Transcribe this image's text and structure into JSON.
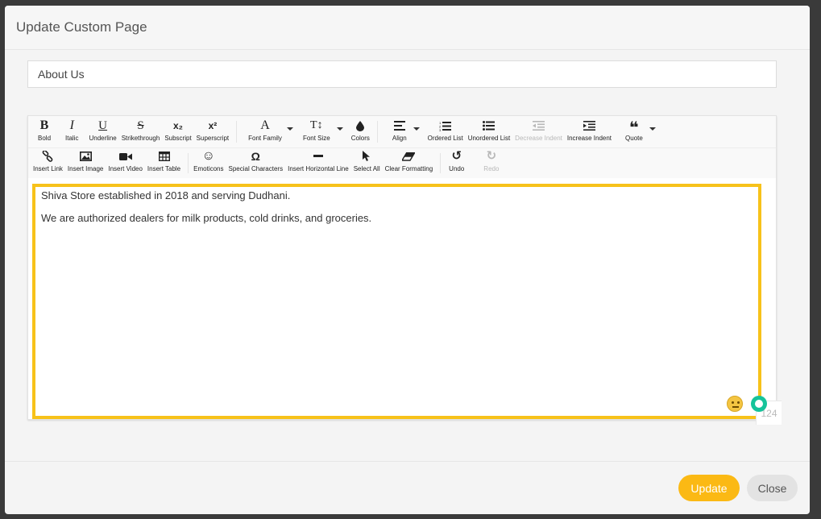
{
  "modal": {
    "title": "Update Custom Page"
  },
  "form": {
    "page_title_value": "About Us"
  },
  "toolbar": {
    "row1": [
      {
        "name": "bold",
        "glyph": "B",
        "label": "Bold"
      },
      {
        "name": "italic",
        "glyph": "I",
        "label": "Italic"
      },
      {
        "name": "underline",
        "glyph": "U",
        "label": "Underline"
      },
      {
        "name": "strikethrough",
        "glyph": "S",
        "label": "Strikethrough"
      },
      {
        "name": "subscript",
        "glyph": "x₂",
        "label": "Subscript"
      },
      {
        "name": "superscript",
        "glyph": "x²",
        "label": "Superscript"
      },
      {
        "name": "font-family",
        "glyph": "A",
        "label": "Font Family"
      },
      {
        "name": "font-size",
        "glyph": "T↕",
        "label": "Font Size"
      },
      {
        "name": "colors",
        "label": "Colors"
      },
      {
        "name": "align",
        "label": "Align"
      },
      {
        "name": "ordered-list",
        "label": "Ordered List"
      },
      {
        "name": "unordered-list",
        "label": "Unordered List"
      },
      {
        "name": "decrease-indent",
        "label": "Decrease Indent"
      },
      {
        "name": "increase-indent",
        "label": "Increase Indent"
      },
      {
        "name": "quote",
        "glyph": "❝",
        "label": "Quote"
      }
    ],
    "row2": [
      {
        "name": "insert-link",
        "label": "Insert Link"
      },
      {
        "name": "insert-image",
        "label": "Insert Image"
      },
      {
        "name": "insert-video",
        "label": "Insert Video"
      },
      {
        "name": "insert-table",
        "label": "Insert Table"
      },
      {
        "name": "emoticons",
        "glyph": "☺",
        "label": "Emoticons"
      },
      {
        "name": "special-characters",
        "glyph": "Ω",
        "label": "Special Characters"
      },
      {
        "name": "insert-horizontal-line",
        "label": "Insert Horizontal Line"
      },
      {
        "name": "select-all",
        "label": "Select All"
      },
      {
        "name": "clear-formatting",
        "label": "Clear Formatting"
      },
      {
        "name": "undo",
        "glyph": "↺",
        "label": "Undo"
      },
      {
        "name": "redo",
        "glyph": "↻",
        "label": "Redo"
      }
    ]
  },
  "editor": {
    "paragraphs": [
      "Shiva Store established in 2018 and serving Dudhani.",
      "We are authorized dealers for milk products, cold drinks, and groceries."
    ],
    "char_count": "124"
  },
  "footer": {
    "update_label": "Update",
    "close_label": "Close"
  },
  "colors": {
    "accent": "#fbb914",
    "highlight": "#f7c21a",
    "disabled": "#b8b8b8"
  }
}
